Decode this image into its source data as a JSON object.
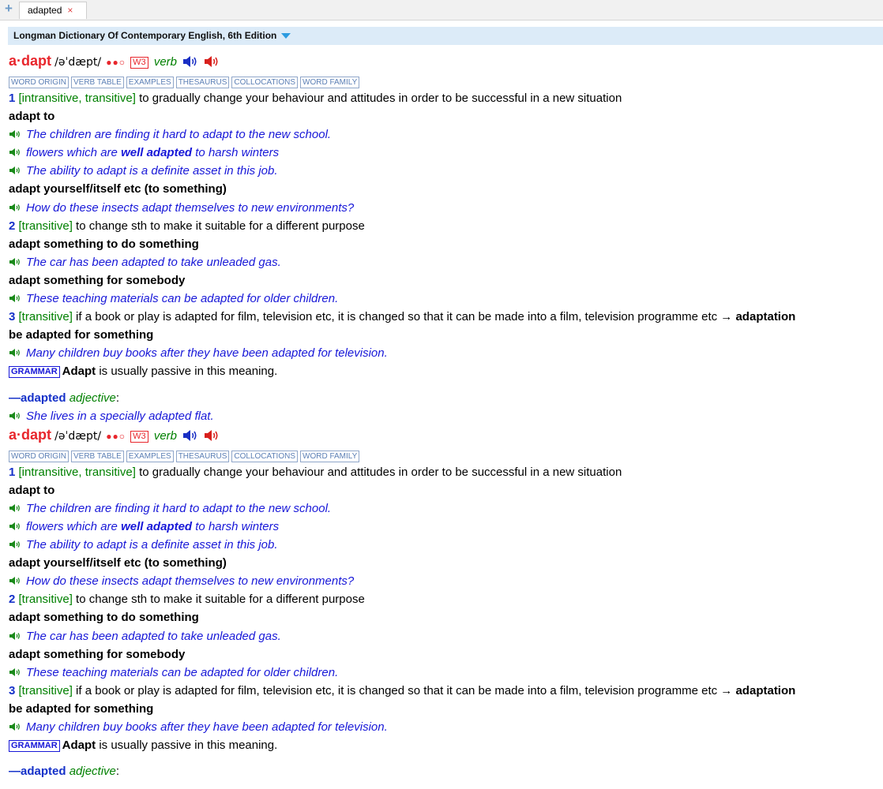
{
  "tab": {
    "label": "adapted",
    "close": "×"
  },
  "dictionary": {
    "name": "Longman Dictionary Of Contemporary English, 6th Edition"
  },
  "icons": {
    "tab_add": "plus-icon",
    "speaker_uk": "speaker-blue-icon",
    "speaker_us": "speaker-red-icon",
    "example_speaker": "speaker-green-icon"
  },
  "colors": {
    "headword": "#e8262c",
    "example": "#1818d8",
    "grammar": "#008000",
    "sense_number": "#1531c9"
  },
  "entry": {
    "headword": "a·dapt",
    "pronunciation": "/əˈdæpt/",
    "frequency": "●●○",
    "written_freq": "W3",
    "pos": "verb",
    "nav_buttons": [
      "WORD ORIGIN",
      "VERB TABLE",
      "EXAMPLES",
      "THESAURUS",
      "COLLOCATIONS",
      "WORD FAMILY"
    ],
    "senses": [
      {
        "num": "1",
        "gram": "[intransitive, transitive]",
        "def": "to gradually change your behaviour and attitudes in order to be successful in a new situation"
      },
      {
        "num": "2",
        "gram": "[transitive]",
        "def": "to change sth to make it suitable for a different purpose"
      },
      {
        "num": "3",
        "gram": "[transitive]",
        "def": "if a book or play is adapted for film, television etc, it is changed so that it can be made into a film, television programme etc →",
        "xref": "adaptation"
      }
    ],
    "patterns": {
      "adapt_to": "adapt to",
      "adapt_yourself": "adapt yourself/itself etc (to something)",
      "adapt_to_do": "adapt something to do something",
      "adapt_for": "adapt something for somebody",
      "be_adapted": "be adapted for something"
    },
    "examples": {
      "e1": "The children are finding it hard to adapt to the new school.",
      "e2_pre": "flowers which are",
      "e2_bold": "well adapted",
      "e2_post": "to harsh winters",
      "e3": "The ability to adapt is a definite asset in this job.",
      "e4": "How do these insects adapt themselves to new environments?",
      "e5": "The car has been adapted to take unleaded gas.",
      "e6": "These teaching materials can be adapted for older children.",
      "e7": "Many children buy books after they have been adapted for television.",
      "e8": "She lives in a specially adapted flat."
    },
    "grammar_note": {
      "label": "GRAMMAR",
      "word": "Adapt",
      "text": "is usually passive in this meaning."
    },
    "derived": {
      "word": "—adapted",
      "pos": "adjective",
      "colon": ":"
    }
  }
}
